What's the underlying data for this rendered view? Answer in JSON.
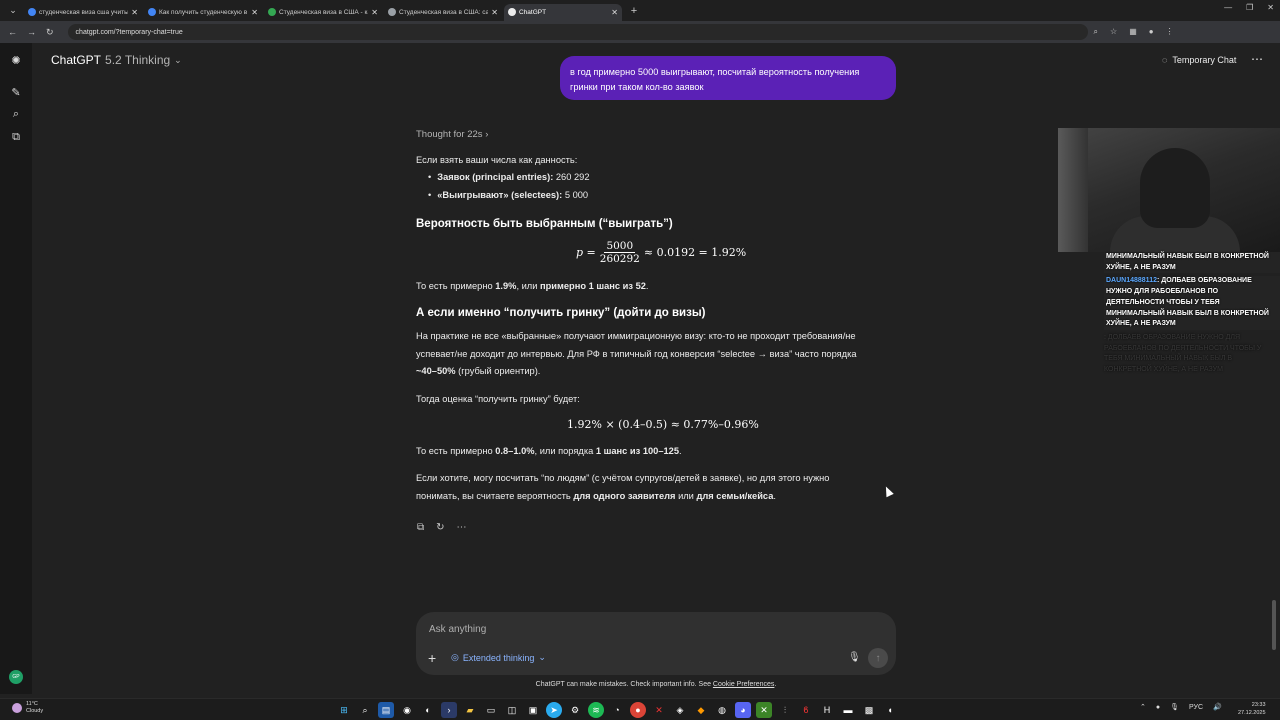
{
  "browser": {
    "tabs": [
      {
        "title": "студенческая виза сша учитыв",
        "color": "#4285f4",
        "active": false
      },
      {
        "title": "Как получить студенческую в",
        "color": "#4285f4",
        "active": false
      },
      {
        "title": "Студенческая виза в США - ка",
        "color": "#34a853",
        "active": false
      },
      {
        "title": "Студенческая виза в США: сам",
        "color": "#9aa0a6",
        "active": false
      },
      {
        "title": "ChatGPT",
        "color": "#ececec",
        "active": true
      }
    ],
    "url": "chatgpt.com/?temporary-chat=true"
  },
  "header": {
    "model": "ChatGPT",
    "version": "5.2 Thinking",
    "temporary_label": "Temporary Chat"
  },
  "user_message": "в год примерно 5000 выигрывают, посчитай вероятность получения гринки при таком кол-во заявок",
  "answer": {
    "thought": "Thought for 22s",
    "intro": "Если взять ваши числа как данность:",
    "bullet1_label": "Заявок (principal entries):",
    "bullet1_value": "260 292",
    "bullet2_label": "«Выигрывают» (selectees):",
    "bullet2_value": "5 000",
    "h1": "Вероятность быть выбранным (“выиграть”)",
    "f1_p": "p =",
    "f1_num": "5000",
    "f1_den": "260292",
    "f1_rest": "≈ 0.0192 = 1.92%",
    "p1_a": "То есть примерно ",
    "p1_b": "1.9%",
    "p1_c": ", или ",
    "p1_d": "примерно 1 шанс из 52",
    "p1_e": ".",
    "h2": "А если именно “получить гринку” (дойти до визы)",
    "p2_l1": "На практике не все «выбранные» получают иммиграционную визу: кто-то не проходит требования/не",
    "p2_l2": "успевает/не доходит до интервью. Для РФ в типичный год конверсия “selectee → виза” часто порядка",
    "p2_l3a": "~40–50%",
    "p2_l3b": " (грубый ориентир).",
    "p3": "Тогда оценка “получить гринку” будет:",
    "f2": "1.92% × (0.4–0.5) ≈ 0.77%–0.96%",
    "p4_a": "То есть примерно ",
    "p4_b": "0.8–1.0%",
    "p4_c": ", или порядка ",
    "p4_d": "1 шанс из 100–125",
    "p4_e": ".",
    "p5_l1": "Если хотите, могу посчитать “по людям” (с учётом супругов/детей в заявке), но для этого нужно",
    "p5_l2a": "понимать, вы считаете вероятность ",
    "p5_l2b": "для одного заявителя",
    "p5_l2c": " или ",
    "p5_l2d": "для семьи/кейса",
    "p5_l2e": "."
  },
  "composer": {
    "placeholder": "Ask anything",
    "mode": "Extended thinking"
  },
  "disclaimer": {
    "text": "ChatGPT can make mistakes. Check important info. See ",
    "link": "Cookie Preferences",
    "end": "."
  },
  "stream_chat": {
    "msg1": "МИНИМАЛЬНЫЙ НАВЫК БЫЛ В КОНКРЕТНОЙ ХУЙНЕ, А НЕ РАЗУМ",
    "msg2_user": "DAUN14888112",
    "msg2_text": ": ДОЛБАЕВ ОБРАЗОВАНИЕ НУЖНО ДЛЯ РАБОЕБЛАНОВ ПО ДЕЯТЕЛЬНОСТИ ЧТОБЫ У ТЕБЯ МИНИМАЛЬНЫЙ НАВЫК БЫЛ В КОНКРЕТНОЙ ХУЙНЕ, А НЕ РАЗУМ"
  },
  "taskbar": {
    "temp": "11°C",
    "weather": "Cloudy",
    "lang": "РУС",
    "time": "23:33",
    "date": "27.12.2025"
  }
}
